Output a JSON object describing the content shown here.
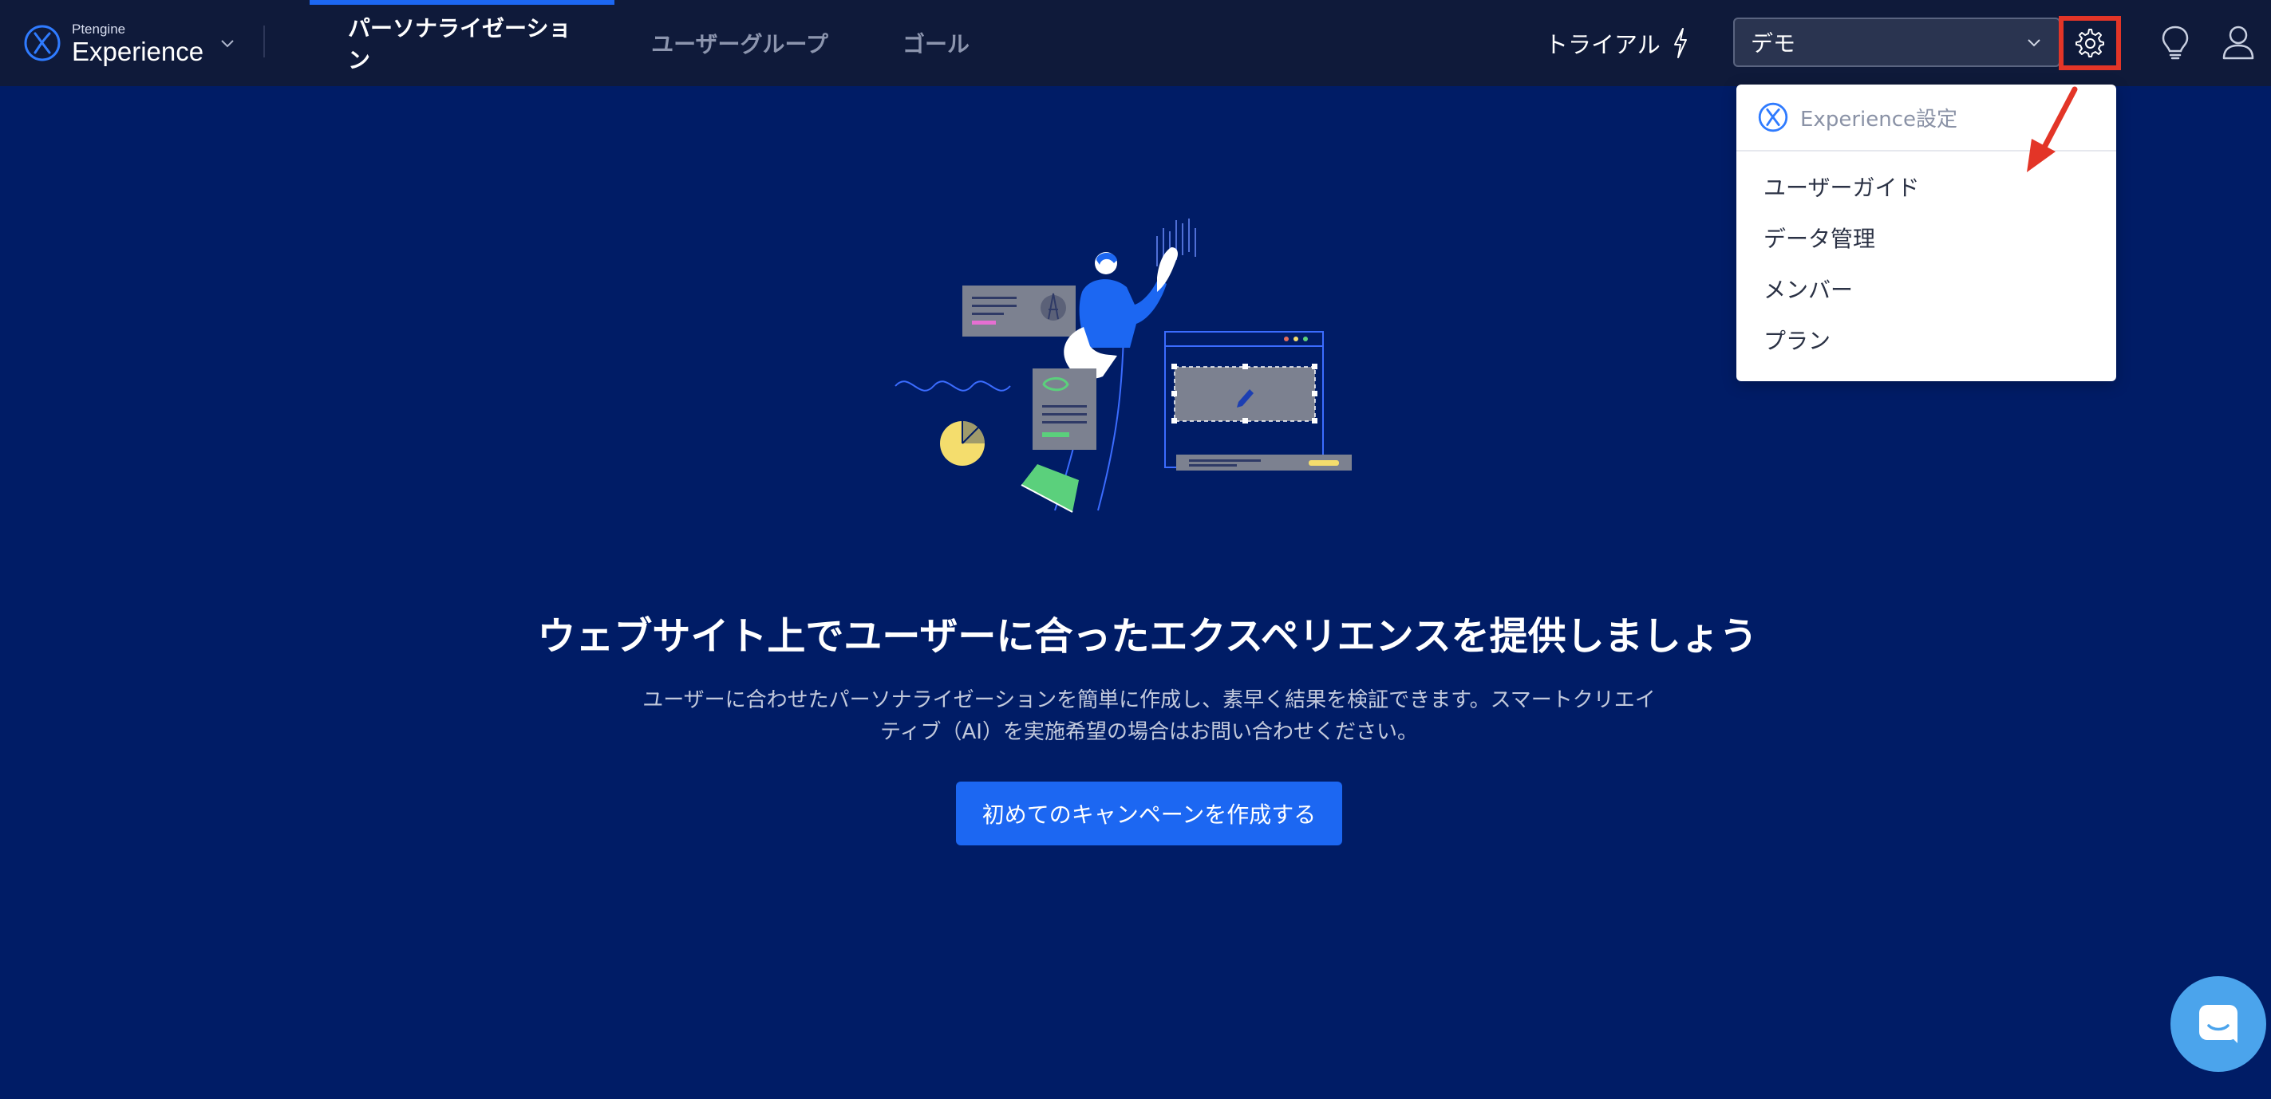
{
  "header": {
    "brand_sub": "Ptengine",
    "brand_main": "Experience",
    "tabs": [
      {
        "label": "パーソナライゼーション",
        "active": true
      },
      {
        "label": "ユーザーグループ",
        "active": false
      },
      {
        "label": "ゴール",
        "active": false
      }
    ],
    "trial_label": "トライアル",
    "project_select_value": "デモ",
    "icons": [
      "experience-logo-icon",
      "chevron-down-icon",
      "lightning-icon",
      "gear-icon",
      "lightbulb-icon",
      "user-icon"
    ]
  },
  "settings_menu": {
    "title": "Experience設定",
    "items": [
      {
        "label": "ユーザーガイド"
      },
      {
        "label": "データ管理"
      },
      {
        "label": "メンバー"
      },
      {
        "label": "プラン"
      }
    ]
  },
  "main": {
    "headline": "ウェブサイト上でユーザーに合ったエクスペリエンスを提供しましょう",
    "description_line1": "ユーザーに合わせたパーソナライゼーションを簡単に作成し、素早く結果を検証できます。スマートクリエイ",
    "description_line2": "ティブ（AI）を実施希望の場合はお問い合わせください。",
    "cta_label": "初めてのキャンペーンを作成する"
  },
  "colors": {
    "background": "#001c66",
    "topbar": "#0f1a3a",
    "accent": "#1c67f2",
    "highlight_annotation": "#e33527",
    "chat": "#4ba4ec"
  }
}
